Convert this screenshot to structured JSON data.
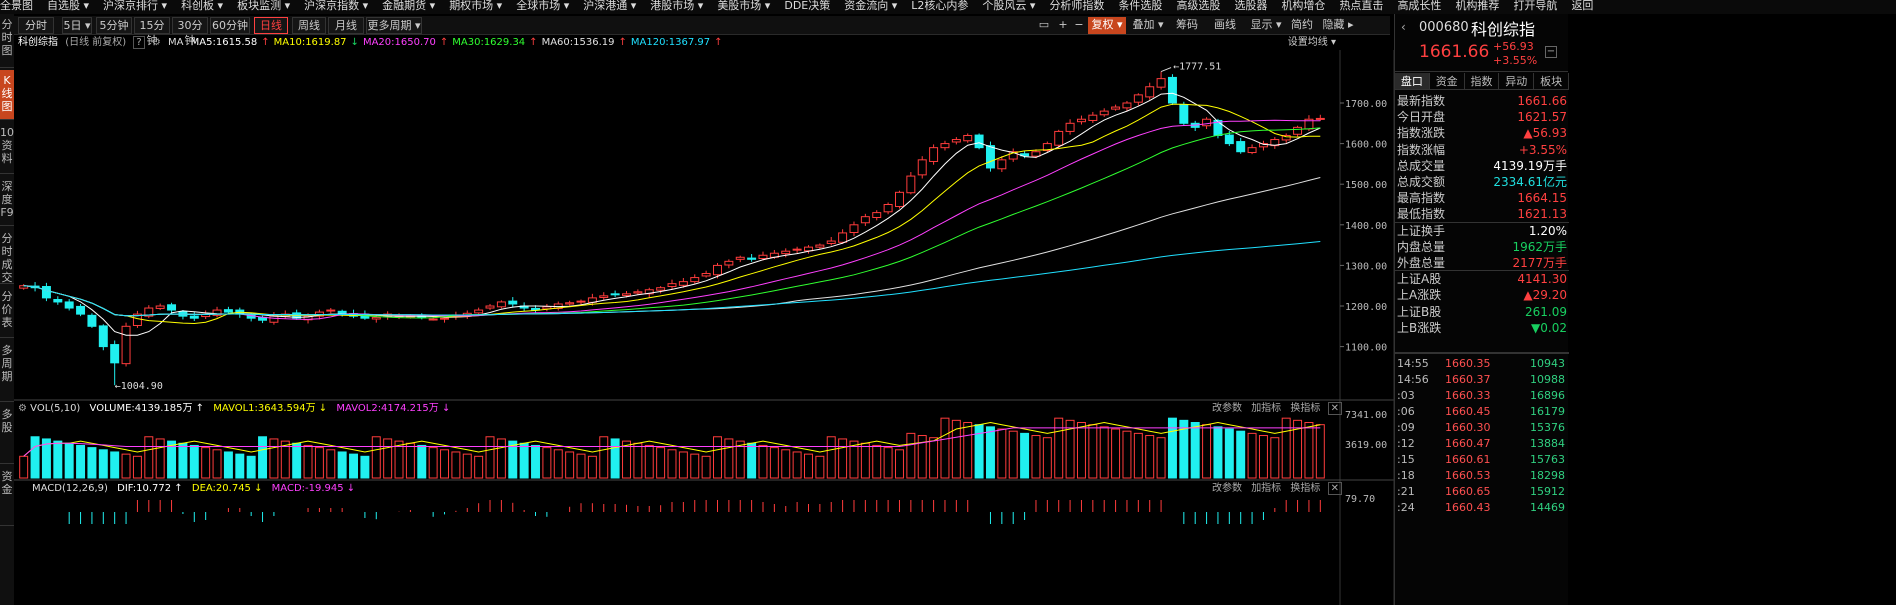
{
  "topmenu": [
    "全景图",
    "自选股 ▾",
    "沪深京排行 ▾",
    "科创板 ▾",
    "板块监测 ▾",
    "沪深京指数 ▾",
    "金融期货 ▾",
    "期权市场 ▾",
    "全球市场 ▾",
    "沪深港通 ▾",
    "港股市场 ▾",
    "美股市场 ▾",
    "DDE决策",
    "资金流向 ▾",
    "L2核心内参",
    "个股风云 ▾",
    "分析师指数",
    "条件选股",
    "高级选股",
    "选股器",
    "机构增仓",
    "热点直击",
    "高成长性",
    "机构推荐",
    "打开导航",
    "返回"
  ],
  "vtabs": [
    "分时图",
    "K线图",
    "10资料",
    "深度F9",
    "分时成交",
    "分价表",
    "多周期",
    "多股",
    "资金"
  ],
  "periods": [
    "分时",
    "5日 ▾",
    "5分钟",
    "15分钟",
    "30分钟",
    "60分钟",
    "日线",
    "周线",
    "月线",
    "更多周期 ▾"
  ],
  "active_period": "日线",
  "toolbar_right": [
    "复权 ▾",
    "叠加 ▾",
    "筹码",
    "画线",
    "显示 ▾",
    "简约",
    "隐藏 ▸"
  ],
  "chart_title": "科创综指",
  "chart_subtitle": "(日线 前复权)",
  "ma_label": "MA",
  "ma": [
    {
      "label": "MA5:1615.58",
      "color": "#ffffff",
      "arrow": "↑"
    },
    {
      "label": "MA10:1619.87",
      "color": "#ffff00",
      "arrow": "↓"
    },
    {
      "label": "MA20:1650.70",
      "color": "#ff40ff",
      "arrow": "↑"
    },
    {
      "label": "MA30:1629.34",
      "color": "#30ff30",
      "arrow": "↑"
    },
    {
      "label": "MA60:1536.19",
      "color": "#e0e0e0",
      "arrow": "↑"
    },
    {
      "label": "MA120:1367.97",
      "color": "#20e0ff",
      "arrow": "↑"
    }
  ],
  "setting_label": "设置均线 ▾",
  "price_axis": [
    "1700.00",
    "1600.00",
    "1500.00",
    "1400.00",
    "1300.00",
    "1200.00",
    "1100.00"
  ],
  "high_marker": "1777.51",
  "low_marker": "1004.90",
  "volume_legend": {
    "title": "VOL(5,10)",
    "volume": "VOLUME:4139.185万 ↑",
    "mavol1": "MAVOL1:3643.594万 ↓",
    "mavol2": "MAVOL2:4174.215万 ↓",
    "actions": [
      "改参数",
      "加指标",
      "换指标"
    ]
  },
  "volume_axis": [
    "7341.00",
    "3619.00"
  ],
  "macd_legend": {
    "title": "MACD(12,26,9)",
    "dif": "DIF:10.772 ↑",
    "dea": "DEA:20.745 ↓",
    "macd": "MACD:-19.945 ↓",
    "actions": [
      "改参数",
      "加指标",
      "换指标"
    ]
  },
  "macd_axis": "79.70",
  "quote": {
    "code": "000680",
    "name": "科创综指",
    "price": "1661.66",
    "change": "+56.93",
    "change_pct": "+3.55%",
    "tabs": [
      "盘口",
      "资金",
      "指数",
      "异动",
      "板块"
    ],
    "rows": [
      {
        "k": "最新指数",
        "v": "1661.66",
        "c": "red"
      },
      {
        "k": "今日开盘",
        "v": "1621.57",
        "c": "red"
      },
      {
        "k": "指数涨跌",
        "v": "▲56.93",
        "c": "red"
      },
      {
        "k": "指数涨幅",
        "v": "+3.55%",
        "c": "red"
      },
      {
        "k": "总成交量",
        "v": "4139.19万手",
        "c": "white"
      },
      {
        "k": "总成交额",
        "v": "2334.61亿元",
        "c": "cyan"
      },
      {
        "k": "最高指数",
        "v": "1664.15",
        "c": "red"
      },
      {
        "k": "最低指数",
        "v": "1621.13",
        "c": "red"
      },
      {
        "k": "上证换手",
        "v": "1.20%",
        "c": "white"
      },
      {
        "k": "内盘总量",
        "v": "1962万手",
        "c": "green"
      },
      {
        "k": "外盘总量",
        "v": "2177万手",
        "c": "red"
      },
      {
        "k": "上证A股",
        "v": "4141.30",
        "c": "red"
      },
      {
        "k": "上A涨跌",
        "v": "▲29.20",
        "c": "red"
      },
      {
        "k": "上证B股",
        "v": "261.09",
        "c": "green"
      },
      {
        "k": "上B涨跌",
        "v": "▼0.02",
        "c": "green"
      }
    ],
    "ticks": [
      {
        "t": "14:55",
        "p": "1660.35",
        "q": "10943"
      },
      {
        "t": "14:56",
        "p": "1660.37",
        "q": "10988"
      },
      {
        "t": ":03",
        "p": "1660.33",
        "q": "16896"
      },
      {
        "t": ":06",
        "p": "1660.45",
        "q": "16179"
      },
      {
        "t": ":09",
        "p": "1660.30",
        "q": "15376"
      },
      {
        "t": ":12",
        "p": "1660.47",
        "q": "13884"
      },
      {
        "t": ":15",
        "p": "1660.61",
        "q": "15763"
      },
      {
        "t": ":18",
        "p": "1660.53",
        "q": "18298"
      },
      {
        "t": ":21",
        "p": "1660.65",
        "q": "15912"
      },
      {
        "t": ":24",
        "p": "1660.43",
        "q": "14469"
      }
    ]
  },
  "chart_data": {
    "type": "candlestick",
    "series_desc": "daily K-line, approx. monthly-spaced closes, 120 bars",
    "closes": [
      1250,
      1245,
      1220,
      1210,
      1195,
      1180,
      1150,
      1100,
      1060,
      1150,
      1180,
      1195,
      1200,
      1190,
      1175,
      1170,
      1180,
      1190,
      1185,
      1180,
      1170,
      1165,
      1175,
      1180,
      1170,
      1175,
      1185,
      1190,
      1180,
      1175,
      1170,
      1172,
      1180,
      1176,
      1175,
      1172,
      1168,
      1170,
      1178,
      1182,
      1190,
      1200,
      1210,
      1205,
      1195,
      1190,
      1198,
      1205,
      1208,
      1212,
      1220,
      1225,
      1228,
      1230,
      1235,
      1240,
      1245,
      1255,
      1260,
      1270,
      1280,
      1300,
      1310,
      1320,
      1315,
      1325,
      1330,
      1335,
      1340,
      1345,
      1350,
      1360,
      1380,
      1400,
      1420,
      1430,
      1450,
      1480,
      1520,
      1560,
      1590,
      1600,
      1610,
      1620,
      1590,
      1540,
      1560,
      1580,
      1570,
      1580,
      1600,
      1630,
      1650,
      1660,
      1670,
      1680,
      1690,
      1700,
      1720,
      1740,
      1760,
      1700,
      1650,
      1640,
      1660,
      1620,
      1600,
      1580,
      1590,
      1600,
      1610,
      1620,
      1640,
      1660,
      1662
    ],
    "ylim": [
      1000,
      1800
    ],
    "high": 1777.51,
    "low": 1004.9
  }
}
